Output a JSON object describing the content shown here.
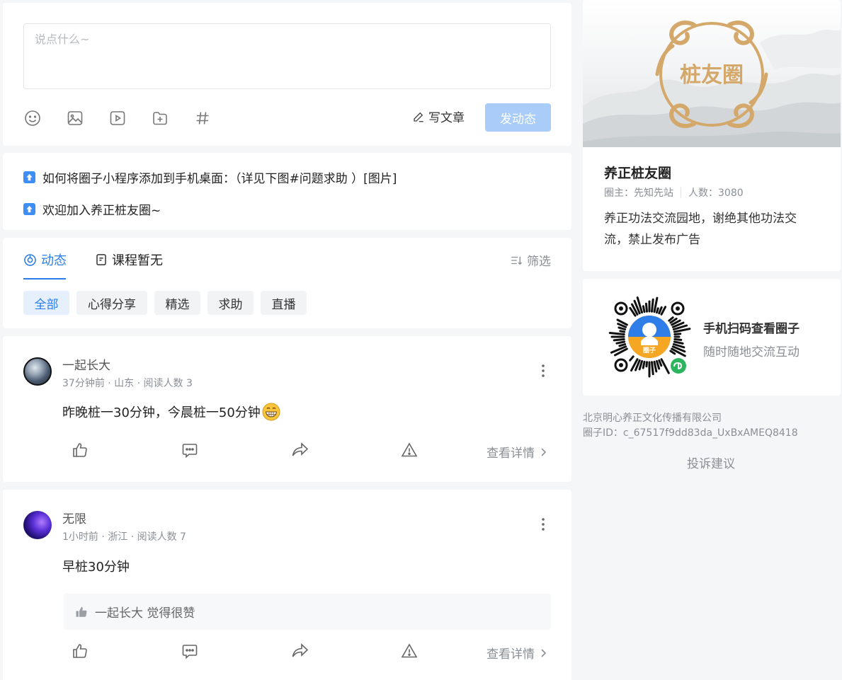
{
  "composer": {
    "placeholder": "说点什么~",
    "write_article_label": "写文章",
    "post_button_label": "发动态",
    "toolbar_icons": [
      "emoji-icon",
      "image-icon",
      "video-icon",
      "file-add-icon",
      "hashtag-icon"
    ]
  },
  "notices": [
    {
      "text": "如何将圈子小程序添加到手机桌面：（详见下图#问题求助 ）[图片]"
    },
    {
      "text": "欢迎加入养正桩友圈~"
    }
  ],
  "tabs": {
    "items": [
      {
        "label": "动态",
        "active": true
      },
      {
        "label": "课程暂无",
        "active": false
      }
    ],
    "filter_label": "筛选",
    "chips": [
      {
        "label": "全部",
        "active": true
      },
      {
        "label": "心得分享",
        "active": false
      },
      {
        "label": "精选",
        "active": false
      },
      {
        "label": "求助",
        "active": false
      },
      {
        "label": "直播",
        "active": false
      }
    ]
  },
  "posts": [
    {
      "author": "一起长大",
      "meta": "37分钟前 · 山东 · 阅读人数 3",
      "content": "昨晚桩一30分钟，今晨桩一50分钟",
      "emoji": "grinning-emoji",
      "detail_label": "查看详情"
    },
    {
      "author": "无限",
      "meta": "1小时前 · 浙江 · 阅读人数 7",
      "content": "早桩30分钟",
      "liked_by": "一起长大 觉得很赞",
      "detail_label": "查看详情"
    }
  ],
  "sidebar": {
    "logo_text": "桩友圈",
    "circle_name": "养正桩友圈",
    "owner": "圈主：先知先站",
    "members": "人数：3080",
    "description": "养正功法交流园地，谢绝其他功法交流，禁止发布广告",
    "qr_title": "手机扫码查看圈子",
    "qr_subtitle": "随时随地交流互动",
    "qr_badge": "圈子",
    "company": "北京明心养正文化传播有限公司",
    "circle_id": "圈子ID：c_67517f9dd83da_UxBxAMEQ8418",
    "complain_label": "投诉建议"
  },
  "colors": {
    "accent": "#2b7de9",
    "post_button_disabled": "#a9cdf8",
    "logo_gold": "#d4a86a"
  }
}
